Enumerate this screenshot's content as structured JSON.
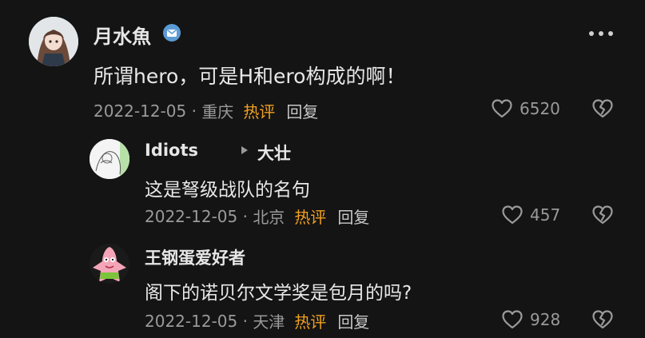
{
  "comment": {
    "author": "月水魚",
    "text": "所谓hero，可是H和ero构成的啊！",
    "date": "2022-12-05",
    "location": "重庆",
    "hot_label": "热评",
    "reply_label": "回复",
    "likes": "6520",
    "badge_icon": "verified-badge-icon",
    "more_icon": "more-dots-icon"
  },
  "replies": [
    {
      "author": "Idiots",
      "reply_to": "大壮",
      "text": "这是弩级战队的名句",
      "date": "2022-12-05",
      "location": "北京",
      "hot_label": "热评",
      "reply_label": "回复",
      "likes": "457"
    },
    {
      "author": "王钢蛋爱好者",
      "text": "阁下的诺贝尔文学奖是包月的吗?",
      "date": "2022-12-05",
      "location": "天津",
      "hot_label": "热评",
      "reply_label": "回复",
      "likes": "928"
    }
  ],
  "colors": {
    "background": "#141414",
    "hot": "#f0a020",
    "meta": "#9a9a9a",
    "badge": "#5b9bd5"
  }
}
